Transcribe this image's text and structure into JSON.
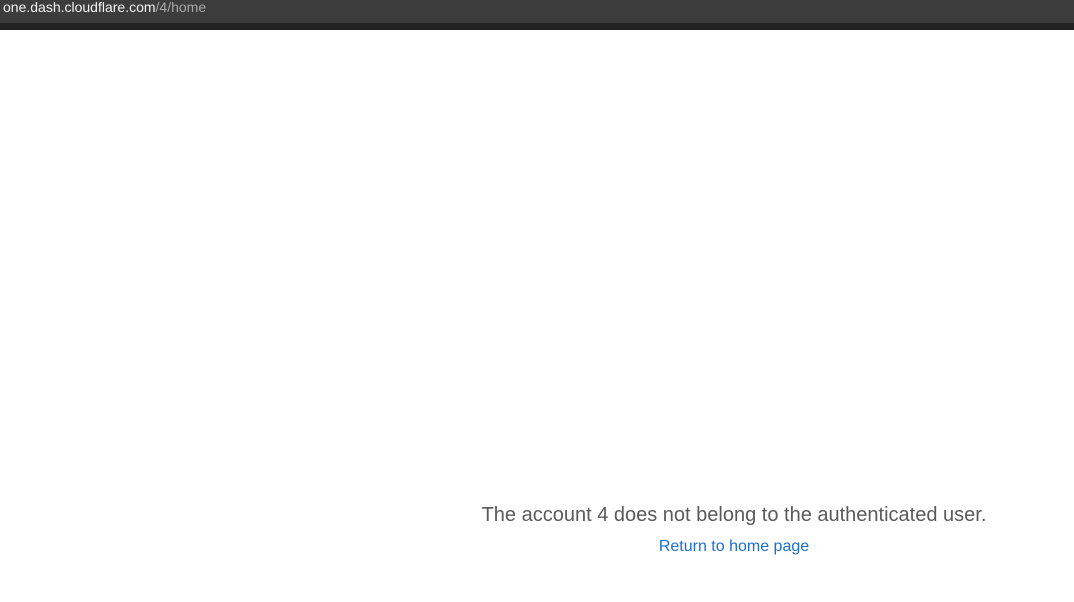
{
  "browser": {
    "url_host": "one.dash.cloudflare.com",
    "url_path": "/4/home"
  },
  "error": {
    "message": "The account 4 does not belong to the authenticated user.",
    "home_link_label": "Return to home page"
  }
}
